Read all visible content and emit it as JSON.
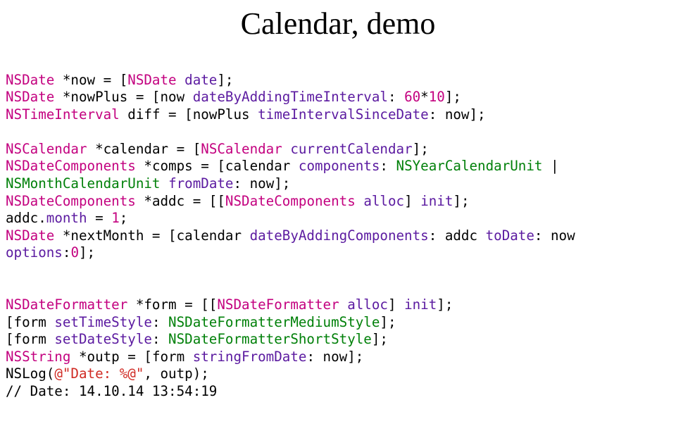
{
  "title": "Calendar, demo",
  "code": {
    "l1": {
      "t1": "NSDate",
      "p1": " *now = [",
      "t2": "NSDate",
      "p2": " ",
      "m1": "date",
      "p3": "];"
    },
    "l2": {
      "t1": "NSDate",
      "p1": " *nowPlus = [now ",
      "m1": "dateByAddingTimeInterval",
      "p2": ": ",
      "n1": "60",
      "p3": "*",
      "n2": "10",
      "p4": "];"
    },
    "l3": {
      "t1": "NSTimeInterval",
      "p1": " diff = [nowPlus ",
      "m1": "timeIntervalSinceDate",
      "p2": ": now];"
    },
    "l5": {
      "t1": "NSCalendar",
      "p1": " *calendar = [",
      "t2": "NSCalendar",
      "p2": " ",
      "m1": "currentCalendar",
      "p3": "];"
    },
    "l6": {
      "t1": "NSDateComponents",
      "p1": " *comps = [calendar ",
      "m1": "components",
      "p2": ": ",
      "id1": "NSYearCalendarUnit",
      "p3": " |"
    },
    "l7": {
      "id1": "NSMonthCalendarUnit",
      "p1": " ",
      "m1": "fromDate",
      "p2": ": now];"
    },
    "l8": {
      "t1": "NSDateComponents",
      "p1": " *addc = [[",
      "t2": "NSDateComponents",
      "p2": " ",
      "m1": "alloc",
      "p3": "] ",
      "m2": "init",
      "p4": "];"
    },
    "l9": {
      "p1": "addc.",
      "m1": "month",
      "p2": " = ",
      "n1": "1",
      "p3": ";"
    },
    "l10": {
      "t1": "NSDate",
      "p1": " *nextMonth = [calendar ",
      "m1": "dateByAddingComponents",
      "p2": ": addc ",
      "m2": "toDate",
      "p3": ": now"
    },
    "l11": {
      "m1": "options",
      "p1": ":",
      "n1": "0",
      "p2": "];"
    },
    "l14": {
      "t1": "NSDateFormatter",
      "p1": " *form = [[",
      "t2": "NSDateFormatter",
      "p2": " ",
      "m1": "alloc",
      "p3": "] ",
      "m2": "init",
      "p4": "];"
    },
    "l15": {
      "p1": "[form ",
      "m1": "setTimeStyle",
      "p2": ": ",
      "id1": "NSDateFormatterMediumStyle",
      "p3": "];"
    },
    "l16": {
      "p1": "[form ",
      "m1": "setDateStyle",
      "p2": ": ",
      "id1": "NSDateFormatterShortStyle",
      "p3": "];"
    },
    "l17": {
      "t1": "NSString",
      "p1": " *outp = [form ",
      "m1": "stringFromDate",
      "p2": ": now];"
    },
    "l18": {
      "p1": "NSLog(",
      "s1": "@\"Date: %@\"",
      "p2": ", outp);"
    },
    "l19": {
      "p1": "// Date: 14.10.14 13:54:19"
    }
  }
}
